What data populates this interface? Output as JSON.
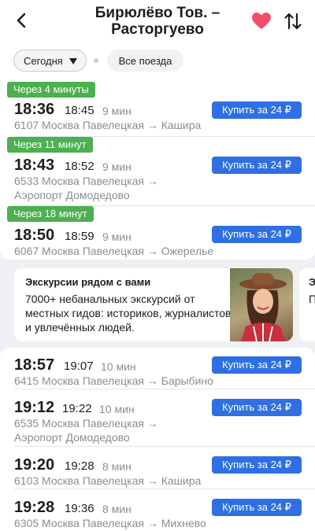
{
  "header": {
    "title_line1": "Бирюлёво Тов. –",
    "title_line2": "Расторгуево",
    "back_icon": "chevron-left-icon",
    "favorite_icon": "heart-icon",
    "swap_icon": "swap-arrows-icon",
    "favorite_color": "#f0506e"
  },
  "filters": {
    "date_label": "Сегодня",
    "all_trains_label": "Все поезда"
  },
  "trains_top": [
    {
      "badge": "Через 4 минуты",
      "dep": "18:36",
      "arr": "18:45",
      "dur": "9 мин",
      "route1": "6107 Москва Павелецкая → Кашира",
      "route2": "",
      "buy": "Купить за 24 ₽"
    },
    {
      "badge": "Через 11 минут",
      "dep": "18:43",
      "arr": "18:52",
      "dur": "9 мин",
      "route1": "6533 Москва Павелецкая →",
      "route2": "Аэропорт Домодедово",
      "buy": "Купить за 24 ₽"
    },
    {
      "badge": "Через 18 минут",
      "dep": "18:50",
      "arr": "18:59",
      "dur": "9 мин",
      "route1": "6067 Москва Павелецкая → Ожерелье",
      "route2": "",
      "buy": "Купить за 24 ₽"
    }
  ],
  "promo": {
    "title": "Экскурсии рядом с вами",
    "text": "7000+ небанальных экскурсий от местных гидов: историков, журналистов и увлечённых людей.",
    "next_title": "Э",
    "next_text": "П"
  },
  "trains_bottom": [
    {
      "dep": "18:57",
      "arr": "19:07",
      "dur": "10 мин",
      "route1": "6415 Москва Павелецкая → Барыбино",
      "route2": "",
      "buy": "Купить за 24 ₽"
    },
    {
      "dep": "19:12",
      "arr": "19:22",
      "dur": "10 мин",
      "route1": "6535 Москва Павелецкая →",
      "route2": "Аэропорт Домодедово",
      "buy": "Купить за 24 ₽"
    },
    {
      "dep": "19:20",
      "arr": "19:28",
      "dur": "8 мин",
      "route1": "6103 Москва Павелецкая → Кашира",
      "route2": "",
      "buy": "Купить за 24 ₽"
    },
    {
      "dep": "19:28",
      "arr": "19:36",
      "dur": "8 мин",
      "route1": "6305 Москва Павелецкая → Михнево",
      "route2": "",
      "buy": "Купить за 24 ₽"
    }
  ],
  "colors": {
    "badge_green": "#4caf50",
    "buy_blue": "#2f6fe4"
  }
}
